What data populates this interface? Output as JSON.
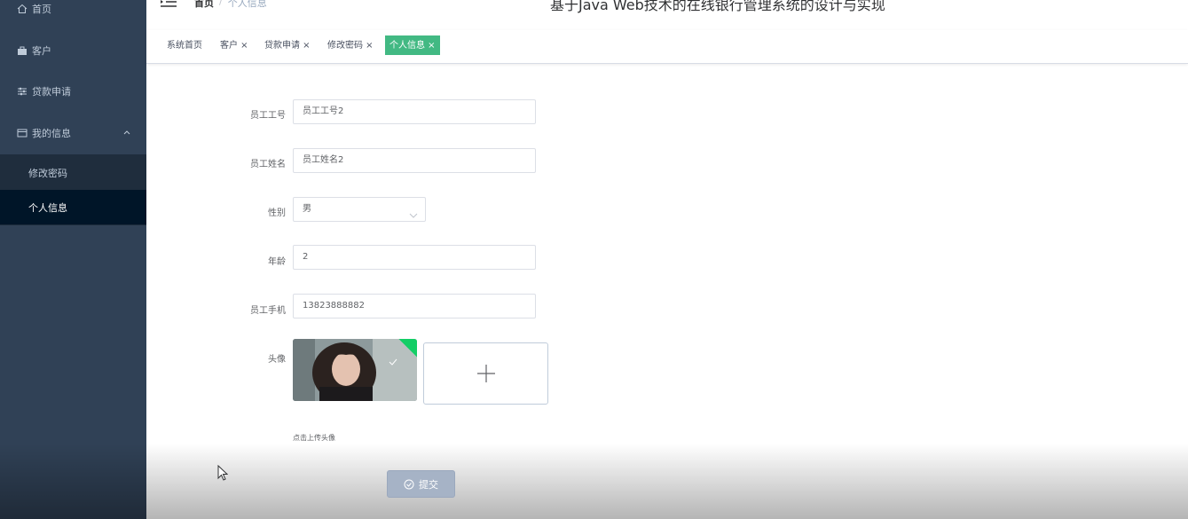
{
  "sidebar": {
    "items": [
      {
        "label": "首页",
        "icon": "home-icon"
      },
      {
        "label": "客户",
        "icon": "briefcase-icon"
      },
      {
        "label": "贷款申请",
        "icon": "sliders-icon"
      },
      {
        "label": "我的信息",
        "icon": "wallet-icon"
      }
    ],
    "submenu": [
      {
        "label": "修改密码"
      },
      {
        "label": "个人信息",
        "active": true
      }
    ]
  },
  "header": {
    "breadcrumb_home": "首页",
    "breadcrumb_sep": "/",
    "breadcrumb_current": "个人信息",
    "title": "基于Java Web技术的在线银行管理系统的设计与实现"
  },
  "tags": [
    {
      "label": "系统首页"
    },
    {
      "label": "客户 ×"
    },
    {
      "label": "贷款申请 ×"
    },
    {
      "label": "修改密码 ×"
    },
    {
      "label": "个人信息 ×",
      "active": true
    }
  ],
  "form": {
    "employee_no": {
      "label": "员工工号",
      "value": "员工工号2"
    },
    "employee_name": {
      "label": "员工姓名",
      "value": "员工姓名2"
    },
    "gender": {
      "label": "性别",
      "value": "男"
    },
    "age": {
      "label": "年龄",
      "value": "2"
    },
    "phone": {
      "label": "员工手机",
      "value": "13823888882"
    },
    "avatar": {
      "label": "头像",
      "upload_tip": "点击上传头像"
    },
    "submit_label": "提交"
  },
  "colors": {
    "sidebar_bg": "#304156",
    "submenu_bg": "#1f2d3d",
    "active_tag": "#42b983",
    "submit_btn": "#a6b3c6"
  }
}
